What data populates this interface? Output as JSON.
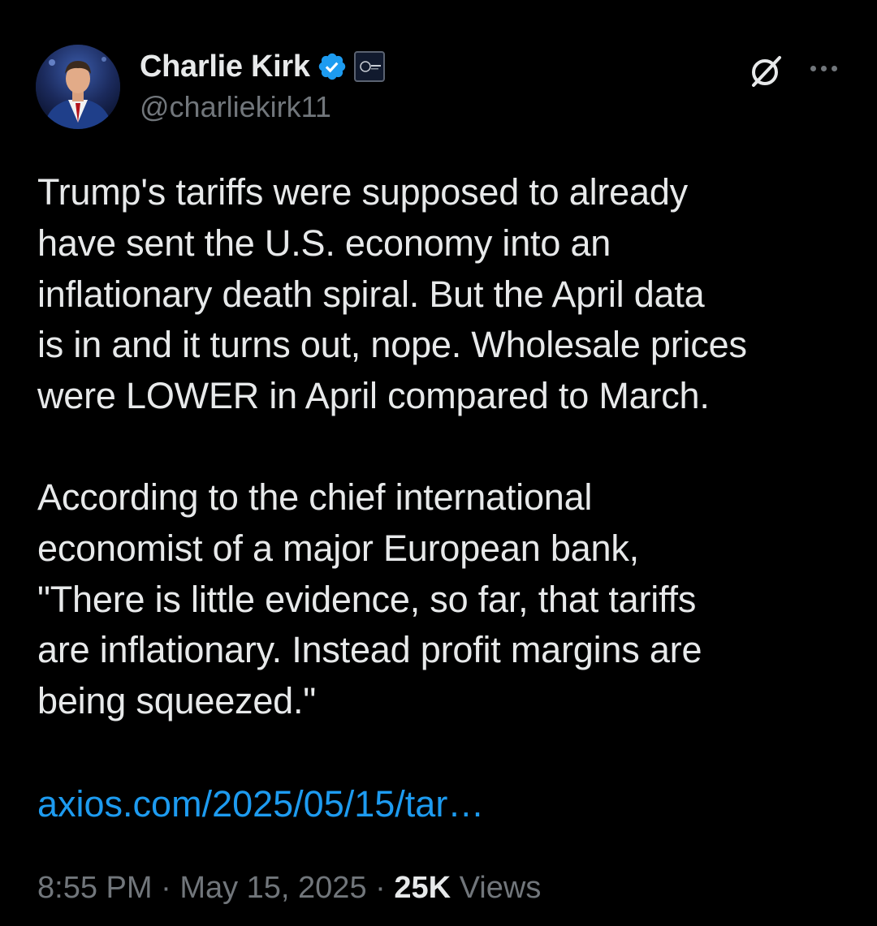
{
  "author": {
    "display_name": "Charlie Kirk",
    "handle": "@charliekirk11",
    "verified": true,
    "verified_badge_color": "#1d9bf0",
    "affiliation_badge_icon": "organization-logo-icon"
  },
  "header_actions": {
    "grok_icon": "grok-icon",
    "more_icon": "more-options-icon"
  },
  "tweet": {
    "paragraph_1": "Trump's tariffs were supposed to already\nhave sent the U.S. economy into an\ninflationary death spiral. But the April data\nis in and it turns out, nope. Wholesale prices\nwere LOWER in April compared to March.",
    "paragraph_2": "According to the chief international\neconomist of a major European bank,\n\"There is little evidence, so far, that tariffs\nare inflationary. Instead profit margins are\nbeing squeezed.\"",
    "link_text": "axios.com/2025/05/15/tar…"
  },
  "meta": {
    "time": "8:55 PM",
    "separator": " · ",
    "date": "May 15, 2025",
    "views_count": "25K",
    "views_label": " Views"
  },
  "colors": {
    "background": "#000000",
    "text_primary": "#e7e9ea",
    "text_secondary": "#71767b",
    "link": "#1d9bf0"
  }
}
